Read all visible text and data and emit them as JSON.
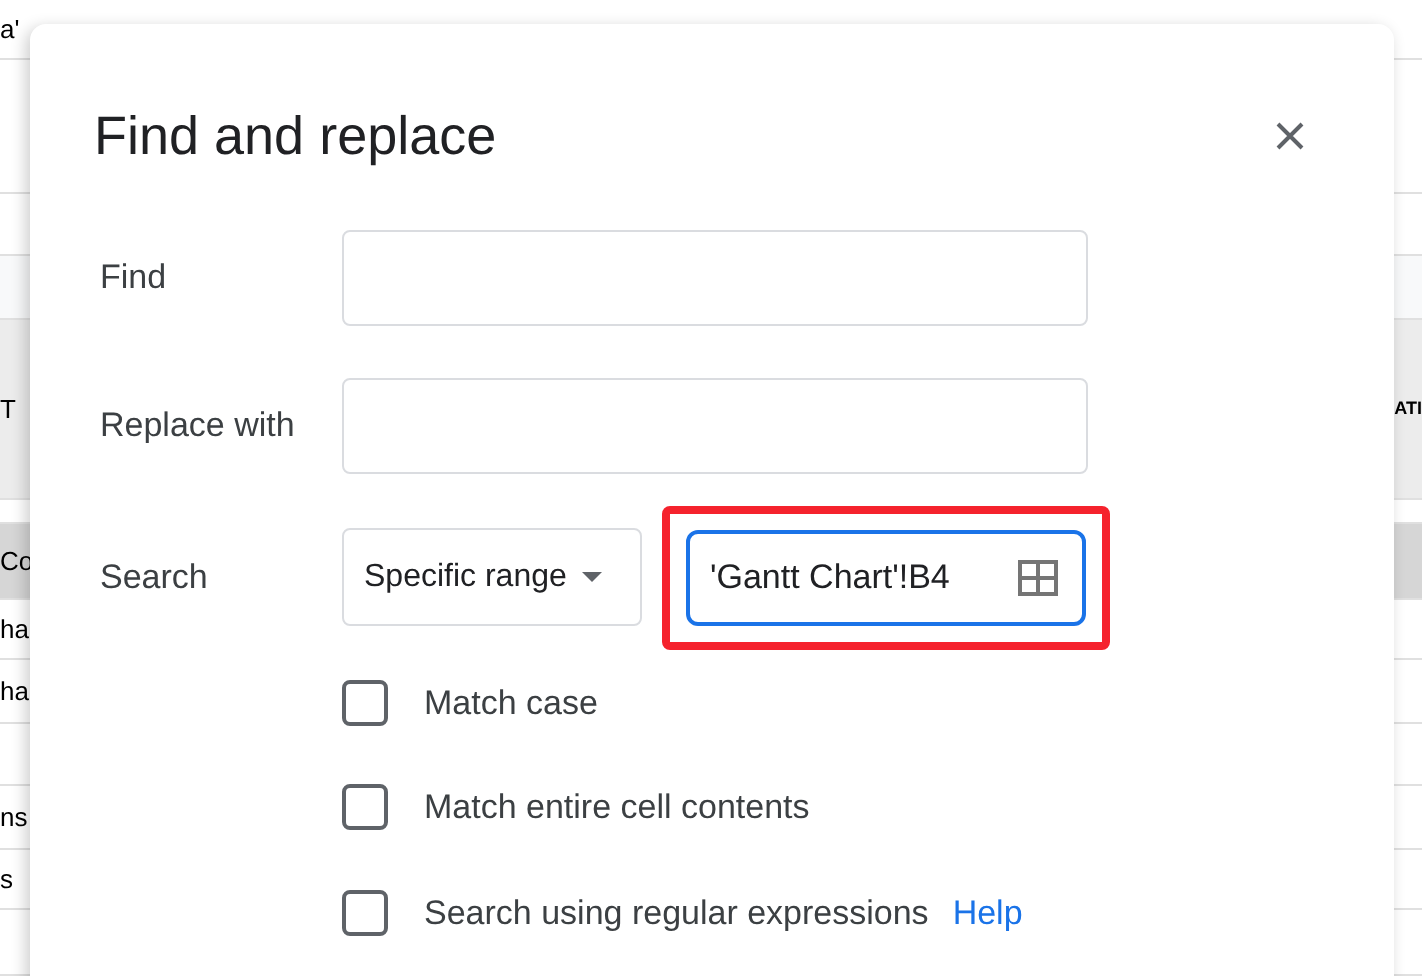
{
  "sheet": {
    "rows": [
      {
        "cell_left": "a'",
        "selected": false
      },
      {
        "selected": false
      },
      {
        "selected": false
      },
      {
        "selected": false
      },
      {
        "cell_left": "T",
        "cell_right": "ATI",
        "selected": false
      },
      {
        "selected": false
      },
      {
        "cell_left": "Co",
        "selected": true
      },
      {
        "cell_left": "ha",
        "selected": false
      },
      {
        "cell_left": "ha",
        "selected": false
      },
      {
        "selected": false
      },
      {
        "cell_left": "ns",
        "selected": false
      },
      {
        "cell_left": "s",
        "selected": false
      },
      {
        "selected": false
      }
    ]
  },
  "dialog": {
    "title": "Find and replace",
    "fields": [
      {
        "label": "Find",
        "kind": "text"
      },
      {
        "label": "Replace with",
        "kind": "text"
      }
    ],
    "search": {
      "label": "Search",
      "scope": "Specific range",
      "range": "'Gantt Chart'!B4",
      "highlighted": true
    },
    "options": [
      {
        "label": "Match case",
        "checked": false
      },
      {
        "label": "Match entire cell contents",
        "checked": false
      },
      {
        "label": "Search using regular expressions",
        "checked": false,
        "link": "Help"
      }
    ]
  }
}
